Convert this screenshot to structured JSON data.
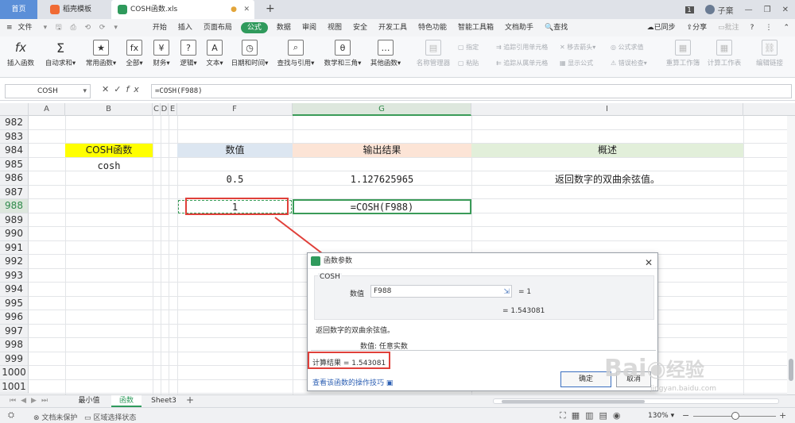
{
  "tabs": {
    "home": "首页",
    "template": "稻壳模板",
    "file": "COSH函数.xls",
    "add": "+"
  },
  "window": {
    "badge": "1",
    "user": "子棄"
  },
  "menu": {
    "file": "文件",
    "items": [
      "开始",
      "插入",
      "页面布局",
      "公式",
      "数据",
      "审阅",
      "视图",
      "安全",
      "开发工具",
      "特色功能",
      "智能工具箱",
      "文档助手"
    ],
    "active_index": 3,
    "search": "查找",
    "sync": "已同步",
    "share": "分享",
    "comment": "批注"
  },
  "ribbon": {
    "insert_fn": "插入函数",
    "autosum": "自动求和",
    "common": "常用函数",
    "all": "全部",
    "finance": "财务",
    "logic": "逻辑",
    "text": "文本",
    "datetime": "日期和时间",
    "lookup": "查找与引用",
    "math": "数学和三角",
    "other": "其他函数",
    "name_mgr": "名称管理器",
    "specify": "指定",
    "paste": "粘贴",
    "trace_prec": "追踪引用单元格",
    "trace_dep": "追踪从属单元格",
    "remove_arrows": "移去箭头",
    "show_formula": "显示公式",
    "eval_formula": "公式求值",
    "error_check": "错误检查",
    "recalc": "重算工作簿",
    "calc_sheet": "计算工作表",
    "edit_links": "编辑链接"
  },
  "formula_bar": {
    "name": "COSH",
    "formula": "=COSH(F988)",
    "fx": "fx"
  },
  "columns": [
    "A",
    "B",
    "C",
    "D",
    "E",
    "F",
    "G",
    "I"
  ],
  "rows": [
    "982",
    "983",
    "984",
    "985",
    "986",
    "987",
    "988",
    "989",
    "990",
    "991",
    "992",
    "993",
    "994",
    "995",
    "996",
    "997",
    "998",
    "999",
    "1000",
    "1001"
  ],
  "cells": {
    "b984": "COSH函数",
    "b985": "cosh",
    "f984": "数值",
    "g984": "输出结果",
    "i984": "概述",
    "f986": "0.5",
    "g986": "1.127625965",
    "i986": "返回数字的双曲余弦值。",
    "f988": "1",
    "g988": "=COSH(F988)"
  },
  "dialog": {
    "title": "函数参数",
    "fn": "COSH",
    "arg_label": "数值",
    "arg_value": "F988",
    "arg_result": "= 1",
    "fn_result": "= 1.543081",
    "desc": "返回数字的双曲余弦值。",
    "arg_desc": "数值:  任意实数",
    "calc_result": "计算结果  =  1.543081",
    "help_link": "查看该函数的操作技巧",
    "ok": "确定",
    "cancel": "取消"
  },
  "sheets": [
    "最小值",
    "函数",
    "Sheet3"
  ],
  "active_sheet": 1,
  "status": {
    "protect": "文档未保护",
    "area": "区域选择状态",
    "zoom": "130%"
  },
  "watermark": {
    "brand": "Bai",
    "suffix": "经验",
    "url": "jingyan.baidu.com"
  },
  "colors": {
    "accent": "#2f9a5c",
    "yellow": "#ffff00",
    "blue_hdr": "#dce6f1",
    "salmon_hdr": "#fce4d6",
    "green_hdr": "#e2efda",
    "red": "#e0403a"
  }
}
